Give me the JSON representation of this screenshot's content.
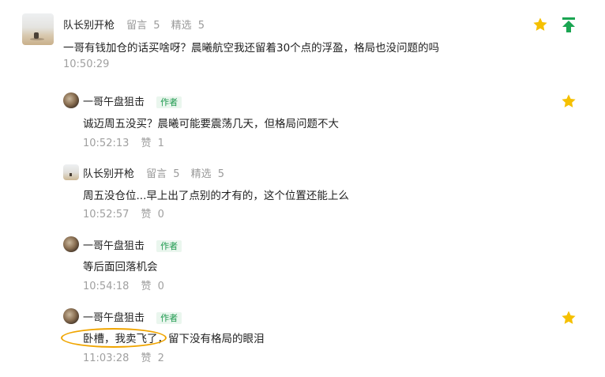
{
  "main_post": {
    "author": "队长别开枪",
    "comments_label": "留言",
    "comments_count": "5",
    "featured_label": "精选",
    "featured_count": "5",
    "content": "一哥有钱加仓的话买啥呀？晨曦航空我还留着30个点的浮盈，格局也没问题的吗",
    "time": "10:50:29"
  },
  "replies": [
    {
      "author": "一哥午盘狙击",
      "badge": "作者",
      "content": "诚迈周五没买？晨曦可能要震荡几天，但格局问题不大",
      "time": "10:52:13",
      "like_label": "赞",
      "like_count": "1",
      "starred": true
    },
    {
      "author": "队长别开枪",
      "comments_label": "留言",
      "comments_count": "5",
      "featured_label": "精选",
      "featured_count": "5",
      "content": "周五没仓位...早上出了点别的才有的，这个位置还能上么",
      "time": "10:52:57",
      "like_label": "赞",
      "like_count": "0"
    },
    {
      "author": "一哥午盘狙击",
      "badge": "作者",
      "content": "等后面回落机会",
      "time": "10:54:18",
      "like_label": "赞",
      "like_count": "0"
    },
    {
      "author": "一哥午盘狙击",
      "badge": "作者",
      "content": "卧槽，我卖飞了，留下没有格局的眼泪",
      "time": "11:03:28",
      "like_label": "赞",
      "like_count": "2",
      "starred": true
    }
  ],
  "colors": {
    "star": "#f5c000",
    "pin": "#1aa552",
    "author_badge": "#1f9a4f",
    "highlight_ring": "#f0a500"
  },
  "icons": {
    "star": "star-icon",
    "pin": "pin-to-top-icon"
  }
}
